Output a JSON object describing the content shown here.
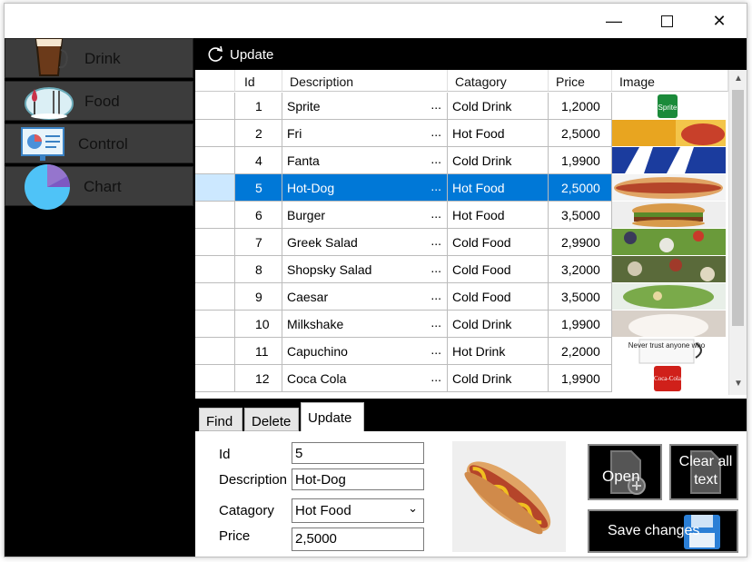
{
  "window": {
    "minimize_glyph": "—",
    "maximize_glyph": "☐",
    "close_glyph": "✕"
  },
  "sidebar": {
    "items": [
      {
        "label": "Drink",
        "icon": "drink-glass-icon"
      },
      {
        "label": "Food",
        "icon": "food-icon"
      },
      {
        "label": "Control",
        "icon": "presentation-icon"
      },
      {
        "label": "Chart",
        "icon": "pie-chart-icon"
      }
    ]
  },
  "toolbar": {
    "update_label": "Update"
  },
  "grid": {
    "columns": [
      "Id",
      "Description",
      "Catagory",
      "Price",
      "Image"
    ],
    "rows": [
      {
        "id": "1",
        "description": "Sprite",
        "category": "Cold Drink",
        "price": "1,2000",
        "image": "sprite"
      },
      {
        "id": "2",
        "description": "Fri",
        "category": "Hot Food",
        "price": "2,5000",
        "image": "fries"
      },
      {
        "id": "4",
        "description": "Fanta",
        "category": "Cold Drink",
        "price": "1,9900",
        "image": "fanta"
      },
      {
        "id": "5",
        "description": "Hot-Dog",
        "category": "Hot Food",
        "price": "2,5000",
        "image": "hotdog",
        "selected": true
      },
      {
        "id": "6",
        "description": "Burger",
        "category": "Hot Food",
        "price": "3,5000",
        "image": "burger"
      },
      {
        "id": "7",
        "description": "Greek Salad",
        "category": "Cold Food",
        "price": "2,9900",
        "image": "salad"
      },
      {
        "id": "8",
        "description": "Shopsky Salad",
        "category": "Cold Food",
        "price": "3,2000",
        "image": "salad2"
      },
      {
        "id": "9",
        "description": "Caesar",
        "category": "Cold Food",
        "price": "3,5000",
        "image": "caesar"
      },
      {
        "id": "10",
        "description": "Milkshake",
        "category": "Cold Drink",
        "price": "1,9900",
        "image": "milkshake"
      },
      {
        "id": "11",
        "description": "Capuchino",
        "category": "Hot Drink",
        "price": "2,2000",
        "image": "mug"
      },
      {
        "id": "12",
        "description": "Coca Cola",
        "category": "Cold Drink",
        "price": "1,9900",
        "image": "cola"
      }
    ],
    "ellipsis": "..."
  },
  "tabs": [
    {
      "label": "Find"
    },
    {
      "label": "Delete"
    },
    {
      "label": "Update",
      "active": true
    }
  ],
  "form": {
    "id_label": "Id",
    "id_value": "5",
    "description_label": "Description",
    "description_value": "Hot-Dog",
    "category_label": "Catagory",
    "category_value": "Hot Food",
    "price_label": "Price",
    "price_value": "2,5000"
  },
  "buttons": {
    "open": "Open",
    "clear": "Clear all text",
    "save": "Save changes"
  },
  "image_text": {
    "sprite": "Sprite",
    "mug": "Never trust anyone who",
    "cola": "Coca-Cola"
  },
  "colors": {
    "selection": "#0078d7",
    "dark": "#000000",
    "nav": "#3c3c3c"
  }
}
